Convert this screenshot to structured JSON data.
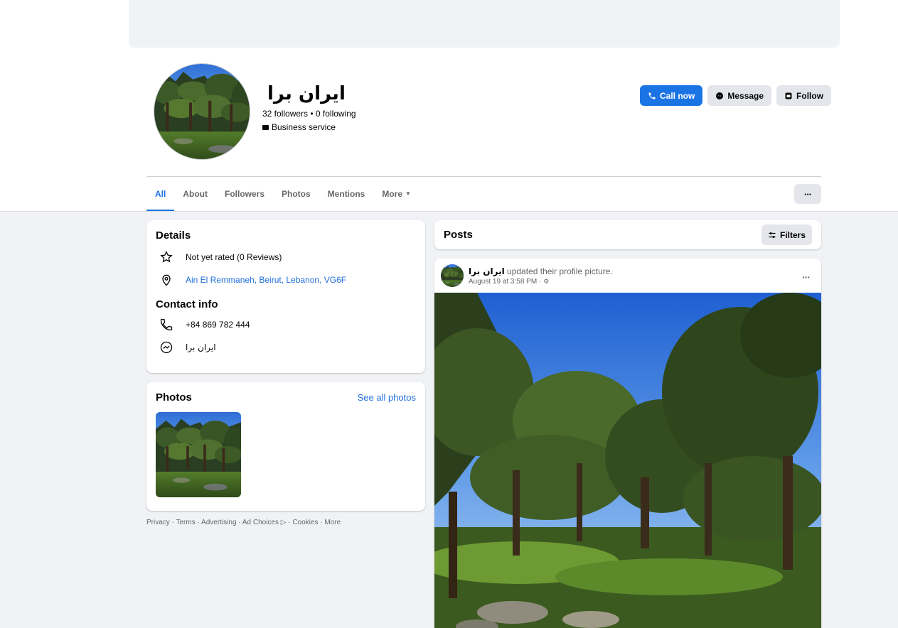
{
  "profile": {
    "name": "ايران برا",
    "counts": "32 followers • 0 following",
    "category": "Business service"
  },
  "actions": {
    "call": "Call now",
    "message": "Message",
    "follow": "Follow"
  },
  "tabs": [
    {
      "label": "All"
    },
    {
      "label": "About"
    },
    {
      "label": "Followers"
    },
    {
      "label": "Photos"
    },
    {
      "label": "Mentions"
    },
    {
      "label": "More"
    }
  ],
  "tab_more_button": "···",
  "details": {
    "title": "Details",
    "rating": "Not yet rated (0 Reviews)",
    "address": "Ain El Remmaneh, Beirut, Lebanon, VG6F"
  },
  "contact": {
    "title": "Contact info",
    "phone": "+84 869 782 444",
    "messenger": "ايران برا"
  },
  "photos": {
    "title": "Photos",
    "see_all": "See all photos"
  },
  "footer": "Privacy · Terms · Advertising · Ad Choices ▷ · Cookies · More",
  "posts": {
    "title": "Posts",
    "filters": "Filters"
  },
  "post": {
    "author": "ايران برا",
    "action": " updated their profile picture.",
    "time": "August 19 at 3:58 PM ·",
    "menu": "···"
  },
  "colors": {
    "accent": "#1b74e4",
    "link": "#216fdb",
    "background": "#f0f2f5"
  }
}
